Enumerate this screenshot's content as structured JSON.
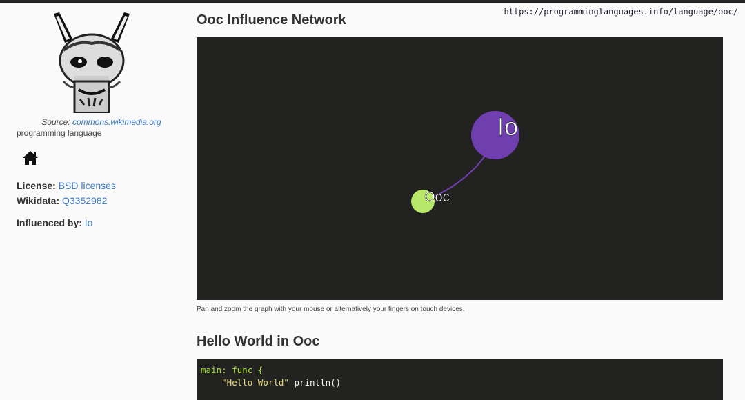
{
  "url": "https://programminglanguages.info/language/ooc/",
  "sidebar": {
    "source_label": "Source:",
    "source_link": "commons.wikimedia.org",
    "type": "programming language",
    "license_label": "License:",
    "license_value": "BSD licenses",
    "wikidata_label": "Wikidata:",
    "wikidata_value": "Q3352982",
    "influenced_label": "Influenced by:",
    "influenced_value": "Io",
    "icons": [
      "llama-logo",
      "home-icon"
    ]
  },
  "main": {
    "graph_title": "Ooc Influence Network",
    "graph": {
      "nodes": [
        {
          "label": "Io",
          "color": "#6f3fb0"
        },
        {
          "label": "Ooc",
          "color": "#b8e86a"
        }
      ],
      "edge_color": "#6f3fb0"
    },
    "caption": "Pan and zoom the graph with your mouse or alternatively your fingers on touch devices.",
    "hello_title": "Hello World in Ooc",
    "code": {
      "line1_kw": "main: func {",
      "line2_str": "\"Hello World\"",
      "line2_rest": " println()"
    }
  }
}
